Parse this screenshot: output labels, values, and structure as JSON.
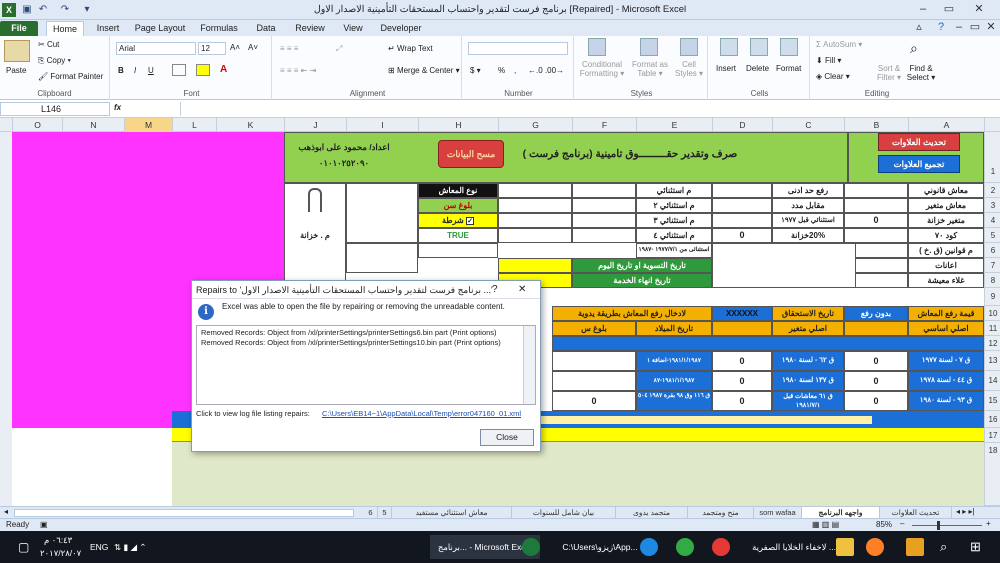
{
  "window": {
    "title": "برنامج فرست لتقدير واحتساب المستحقات التأمينية الاصدار الاول  [Repaired]  -  Microsoft Excel",
    "controls": {
      "help": "?",
      "minimize": "–",
      "restore": "▭",
      "close": "✕"
    }
  },
  "ribbon_tabs": [
    "File",
    "Home",
    "Insert",
    "Page Layout",
    "Formulas",
    "Data",
    "Review",
    "View",
    "Developer"
  ],
  "ribbon": {
    "clipboard": {
      "paste": "Paste",
      "cut": "Cut",
      "copy": "Copy ▾",
      "format_painter": "Format Painter",
      "label": "Clipboard"
    },
    "font": {
      "name": "Arial",
      "size": "12",
      "bold": "B",
      "italic": "I",
      "underline": "U",
      "grow": "A˄",
      "shrink": "A˅",
      "color": "A",
      "label": "Font"
    },
    "alignment": {
      "wrap": "Wrap Text",
      "merge": "Merge & Center ▾",
      "label": "Alignment"
    },
    "number": {
      "format": "",
      "currency": "$ ▾",
      "percent": "%",
      "comma": ",",
      "label": "Number"
    },
    "styles": {
      "conditional": "Conditional Formatting ▾",
      "format_table": "Format as Table ▾",
      "cell_styles": "Cell Styles ▾",
      "label": "Styles"
    },
    "cells": {
      "insert": "Insert",
      "delete": "Delete",
      "format": "Format",
      "label": "Cells"
    },
    "editing": {
      "autosum": "AutoSum ▾",
      "fill": "Fill ▾",
      "clear": "Clear ▾",
      "sort": "Sort & Filter ▾",
      "find": "Find & Select ▾",
      "label": "Editing"
    }
  },
  "formula_bar": {
    "name_box": "L146",
    "fx": "fx",
    "formula": ""
  },
  "columns": [
    "O",
    "N",
    "M",
    "L",
    "K",
    "J",
    "I",
    "H",
    "G",
    "F",
    "E",
    "D",
    "C",
    "B",
    "A"
  ],
  "selected_column": "M",
  "rows": [
    "1",
    "2",
    "3",
    "4",
    "5",
    "6",
    "7",
    "8",
    "9",
    "10",
    "11",
    "12",
    "13",
    "14",
    "15",
    "16",
    "17",
    "18"
  ],
  "sheet": {
    "btn_update": "تحديث العلاوات",
    "btn_group": "تجميع العلاوات",
    "btn_clear": "مسح البيانات",
    "main_title": "صرف وتقدير حقـــــــــوق تامينية (برنامج فرست )",
    "author": "اعداد/ محمود على ابوذهب",
    "phone": "٠١٠١٠٢٥٢٠٩٠",
    "labels": {
      "legal": "معاش قانوني",
      "variable": "معاش متغير",
      "treasury": "متغير خزانة",
      "code": "كود ٧٠",
      "laws": "م قوانين (ق .خ )",
      "benefits": "اعانات",
      "living": "غلاء معيشة",
      "min_raise": "رفع حد ادنى",
      "compensation": "مقابل مدد",
      "exc1977": "استثنائي قبل ١٩٧٧",
      "pct": "20%خزانة",
      "exc": "م استثنائي",
      "exc2": "م استثنائي ٢",
      "exc3": "م استثنائي ٣",
      "exc4": "م استثنائي ٤",
      "exc_from": "استثنائى من ١٩٧٧/٧/١ -١٩٨٧",
      "pension_type": "نوع المعاش",
      "age": "بلوغ سن",
      "condition": "شرطة",
      "true": "TRUE",
      "treasury_m": "م . خزانة",
      "settlement": "تاريخ التسوية او تاريخ اليوم",
      "service_end": "تاريخ انهاء الخدمة",
      "raise_value": "قيمة رفع المعاش",
      "no_raise": "بدون رفع",
      "due_date": "تاريخ الاستحقاق",
      "xxx": "XXXXXX",
      "manual": "لادخال رفع المعاش بطريقة يدوية",
      "basic": "اصلي اساسي",
      "var_orig": "اصلي متغير",
      "birth": "تاريخ الميلاد",
      "age2": "بلوغ س"
    },
    "values": {
      "b4": "0",
      "d5": "0"
    },
    "rows_data": [
      {
        "a": "ق ٧ - لسنة ١٩٧٧",
        "b": "0",
        "c": "ق ٦٢ - لسنة ١٩٨٠",
        "d": "0",
        "e": "١٩٨١/١/١٩٨٧-اضافة ١"
      },
      {
        "a": "ق ٤٤ - لسنة ١٩٧٨",
        "b": "0",
        "c": "ق ١٣٧ لسنة ١٩٨٠",
        "d": "0",
        "e": "١٩٨١/١/١٩٨٧-٨٧"
      },
      {
        "a": "ق ٩٣ - لسنة ١٩٨٠",
        "b": "0",
        "c": "ق ٦١ معاشات قبل ١٩٨١/٧/١",
        "d": "0",
        "e": "ق ١١٦ وق ٩٨ بقرة ١٩٨٧ ٥٠٤"
      }
    ],
    "row15": "0"
  },
  "dialog": {
    "title": "Repairs to  'برنامج فرست لتقدير واحتساب المستحقات التأمينية الاصدار الاول ...'",
    "help": "?",
    "close_x": "✕",
    "message": "Excel was able to open the file by repairing or removing the unreadable content.",
    "details": [
      "Removed Records: Object from /xl/printerSettings/printerSettings6.bin part (Print options)",
      "Removed Records: Object from /xl/printerSettings/printerSettings10.bin part (Print options)"
    ],
    "log_prompt": "Click to view log file listing repairs:",
    "log_link": "C:\\Users\\EB14~1\\AppData\\Local\\Temp\\error047160_01.xml",
    "close_button": "Close"
  },
  "sheet_tabs": [
    "تحديث العلاوات",
    "واجهه البرنامج",
    "som wafaa",
    "منح ومتجمد",
    "متجمد يدوى",
    "بيان شامل للسنوات",
    "معاش استثنائي مستفيد",
    "5",
    "6"
  ],
  "active_sheet": "واجهه البرنامج",
  "status": {
    "ready": "Ready",
    "zoom": "85%",
    "zoom_minus": "–",
    "zoom_plus": "+"
  },
  "taskbar": {
    "time": "٠٦:٤٣ م",
    "date": "٢٠١٧/٢٨/٠٧",
    "lang": "ENG",
    "apps": [
      "برنامج... - Microsoft Excel",
      "C:\\Users\\زيزو\\App...",
      "لاخفاء الخلايا الصفرية ..."
    ]
  },
  "colors": {
    "magenta": "#ff33ff",
    "green": "#92d050",
    "yellow": "#ffff00",
    "orange": "#f4b000",
    "blue": "#1b6fd6",
    "red_btn": "#d84040"
  }
}
